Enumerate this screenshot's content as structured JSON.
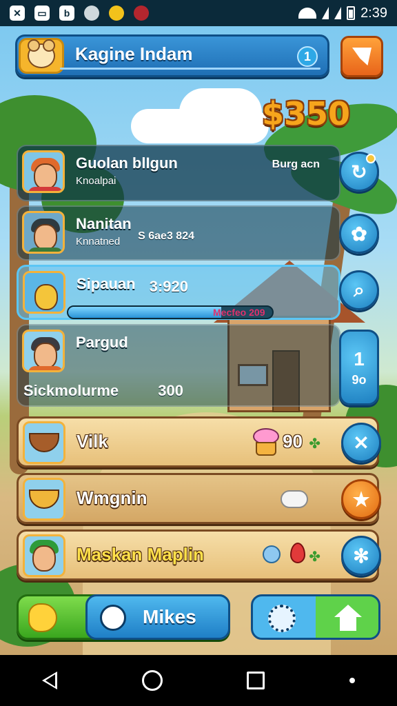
{
  "status_bar": {
    "time": "2:39",
    "icons": [
      "app-x-icon",
      "photo-icon",
      "b-icon",
      "clock-icon",
      "sun-icon",
      "red-app-icon",
      "wifi-icon",
      "signal-icon",
      "battery-icon"
    ]
  },
  "header": {
    "title": "Kagine Indam",
    "notification_count": "1"
  },
  "coins": "$350",
  "players": [
    {
      "name": "Guolan blIgun",
      "sub": "Knoalpai",
      "right": "Burg acn"
    },
    {
      "name": "Nanitan",
      "sub": "Knnatned",
      "right": "S 6ae3 824"
    },
    {
      "name": "Sipauan",
      "sub": "",
      "right": "3:920",
      "progress_label": "Mecfeo 209",
      "progress": 0.75
    },
    {
      "name": "Pargud",
      "sub": "Sickmolurme",
      "right": "300"
    }
  ],
  "side_buttons": {
    "tall_number": "1",
    "tall_sub": "9o"
  },
  "items": [
    {
      "name": "Vilk",
      "value": "90"
    },
    {
      "name": "Wmgnin",
      "value": ""
    },
    {
      "name": "Maskan Maplin",
      "value": ""
    }
  ],
  "bottom_bar": {
    "center_label": "Mikes"
  },
  "colors": {
    "accent_blue": "#1f7fc6",
    "accent_orange": "#e8641a",
    "coin_orange": "#f6a51c"
  }
}
